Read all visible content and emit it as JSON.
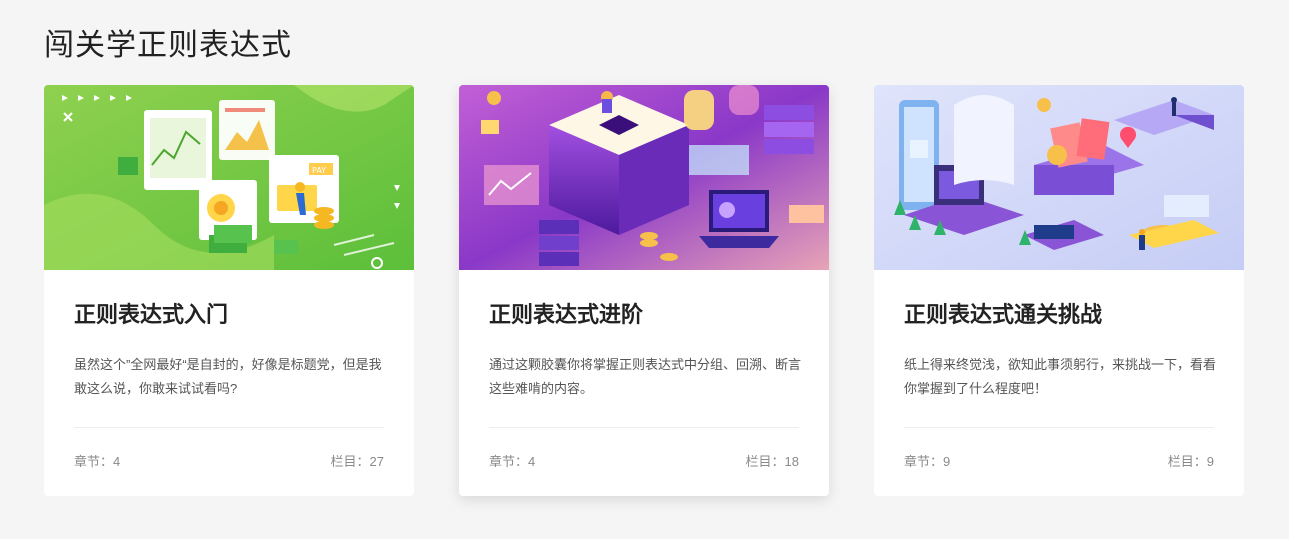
{
  "page": {
    "title": "闯关学正则表达式"
  },
  "cards": [
    {
      "title": "正则表达式入门",
      "description": "虽然这个”全网最好“是自封的，好像是标题党，但是我敢这么说，你敢来试试看吗?",
      "chapters_label": "章节：4",
      "sections_label": "栏目：27",
      "banner_icon": "finance-dashboard-illustration",
      "accent": "#7cc83e"
    },
    {
      "title": "正则表达式进阶",
      "description": "通过这颗胶囊你将掌握正则表达式中分组、回溯、断言这些难啃的内容。",
      "chapters_label": "章节：4",
      "sections_label": "栏目：18",
      "banner_icon": "isometric-data-platform-illustration",
      "accent": "#8a3fc9"
    },
    {
      "title": "正则表达式通关挑战",
      "description": "纸上得来终觉浅，欲知此事须躬行，来挑战一下，看看你掌握到了什么程度吧！",
      "chapters_label": "章节：9",
      "sections_label": "栏目：9",
      "banner_icon": "isometric-challenge-illustration",
      "accent": "#7b73e0"
    }
  ]
}
